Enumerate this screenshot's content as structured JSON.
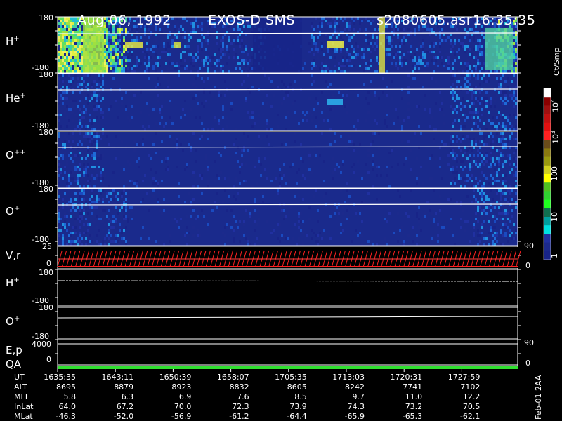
{
  "header": {
    "date": "Aug 06, 1992",
    "instrument": "EXOS-D SMS",
    "file": "s2080605.asr",
    "time": "16:35:35"
  },
  "panels": [
    {
      "id": "h",
      "label_base": "H",
      "label_sup": "+",
      "ytop": "180",
      "ybot": "-180"
    },
    {
      "id": "he",
      "label_base": "He",
      "label_sup": "+",
      "ytop": "180",
      "ybot": "-180"
    },
    {
      "id": "o2",
      "label_base": "O",
      "label_sup": "++",
      "ytop": "180",
      "ybot": "-180"
    },
    {
      "id": "o",
      "label_base": "O",
      "label_sup": "+",
      "ytop": "180",
      "ybot": "-180"
    },
    {
      "id": "vr",
      "label": "V,r",
      "ytop": "25",
      "ybot": "0",
      "right": "90",
      "right_bottom": "0"
    },
    {
      "id": "h2",
      "label_base": "H",
      "label_sup": "+",
      "ytop": "180",
      "ybot": "-180"
    },
    {
      "id": "o3",
      "label_base": "O",
      "label_sup": "+",
      "ytop": "180",
      "ybot": "-180"
    },
    {
      "id": "ep",
      "label": "E,p",
      "ytop": "4000",
      "right": "90"
    },
    {
      "id": "qa",
      "label": "QA",
      "ybot": "0",
      "right": "0"
    }
  ],
  "colorbar": {
    "unit": "Ct/Smp",
    "labels": [
      "10",
      "4",
      "10",
      "3",
      "100",
      "10",
      "1"
    ],
    "colors": [
      "#ffffff",
      "#8b0000",
      "#a01010",
      "#c01010",
      "#e01010",
      "#ff2020",
      "#6b4c1a",
      "#8a7a10",
      "#9a9a10",
      "#d0d020",
      "#ffff00",
      "#50c020",
      "#30d030",
      "#20ff20",
      "#107050",
      "#00a0a0",
      "#00e0e0",
      "#2030a0",
      "#1c2a8c",
      "#182488"
    ]
  },
  "table": {
    "rows": [
      {
        "name": "UT",
        "values": [
          "1635:35",
          "1643:11",
          "1650:39",
          "1658:07",
          "1705:35",
          "1713:03",
          "1720:31",
          "1727:59"
        ]
      },
      {
        "name": "ALT",
        "values": [
          "8695",
          "8879",
          "8923",
          "8832",
          "8605",
          "8242",
          "7741",
          "7102"
        ]
      },
      {
        "name": "MLT",
        "values": [
          "5.8",
          "6.3",
          "6.9",
          "7.6",
          "8.5",
          "9.7",
          "11.0",
          "12.2"
        ]
      },
      {
        "name": "InLat",
        "values": [
          "64.0",
          "67.2",
          "70.0",
          "72.3",
          "73.9",
          "74.3",
          "73.2",
          "70.5"
        ]
      },
      {
        "name": "MLat",
        "values": [
          "-46.3",
          "-52.0",
          "-56.9",
          "-61.2",
          "-64.4",
          "-65.9",
          "-65.3",
          "-62.1"
        ]
      }
    ]
  },
  "footer_note": "Feb-01 2AA",
  "chart_data": {
    "type": "heatmap",
    "title": "Aug 06, 1992   EXOS-D SMS",
    "x_labels": [
      "1635:35",
      "1643:11",
      "1650:39",
      "1658:07",
      "1705:35",
      "1713:03",
      "1720:31",
      "1727:59"
    ],
    "y_range": [
      -180,
      180
    ],
    "color_scale": "log",
    "color_unit": "Ct/Smp",
    "color_range": [
      1,
      10000
    ],
    "series": [
      {
        "name": "H+",
        "intensity_profile": [
          3,
          3,
          3,
          2,
          2,
          2,
          2,
          2,
          2,
          1,
          1,
          2,
          2,
          2,
          2,
          2,
          2,
          2,
          2,
          3
        ]
      },
      {
        "name": "He+",
        "intensity_profile": [
          2,
          2,
          1,
          1,
          1,
          1,
          1,
          1,
          1,
          1,
          1,
          1,
          1,
          1,
          1,
          1,
          1,
          2,
          2,
          2
        ]
      },
      {
        "name": "O++",
        "intensity_profile": [
          2,
          2,
          1,
          1,
          1,
          1,
          1,
          1,
          1,
          1,
          1,
          1,
          1,
          1,
          1,
          1,
          1,
          2,
          2,
          2
        ]
      },
      {
        "name": "O+",
        "intensity_profile": [
          2,
          2,
          2,
          1,
          1,
          1,
          1,
          1,
          1,
          1,
          1,
          1,
          1,
          1,
          1,
          1,
          1,
          1,
          2,
          2
        ]
      }
    ]
  }
}
